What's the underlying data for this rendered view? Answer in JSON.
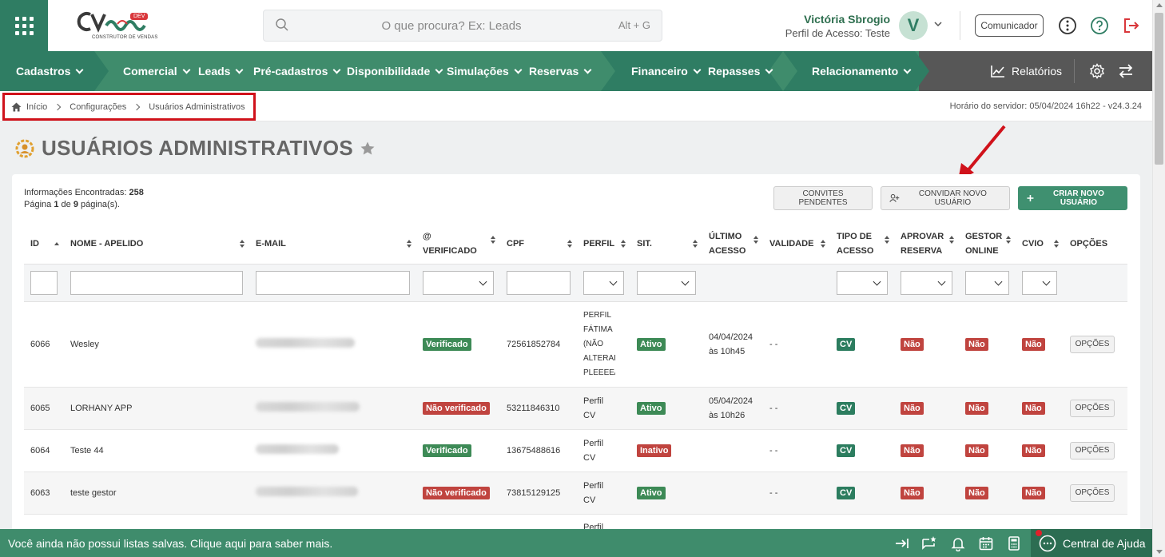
{
  "header": {
    "logo_tag": "DEV",
    "logo_sub": "CONSTRUTOR DE VENDAS",
    "search_placeholder": "O que procura? Ex: Leads",
    "search_shortcut": "Alt + G",
    "user_name": "Victória Sbrogio",
    "user_profile": "Perfil de Acesso: Teste",
    "avatar_letter": "V",
    "communicator_label": "Comunicador"
  },
  "nav": {
    "items": [
      "Cadastros",
      "Comercial",
      "Leads",
      "Pré-cadastros",
      "Disponibilidade",
      "Simulações",
      "Reservas",
      "Financeiro",
      "Repasses",
      "Relacionamento"
    ],
    "reports": "Relatórios",
    "colors": {
      "main": "#3f8c6c",
      "dark": "#2f7d63",
      "gray": "#575757"
    }
  },
  "breadcrumb": {
    "items": [
      "Início",
      "Configurações",
      "Usuários Administrativos"
    ],
    "server_time": "Horário do servidor: 05/04/2024 16h22 - v24.3.24"
  },
  "page": {
    "title": "USUÁRIOS ADMINISTRATIVOS"
  },
  "summary": {
    "found_label": "Informações Encontradas:",
    "found_count": "258",
    "page_label_1": "Página",
    "page_current": "1",
    "page_label_2": "de",
    "page_total": "9",
    "page_label_3": "página(s)."
  },
  "actions": {
    "pending_invites": "CONVITES PENDENTES",
    "invite_user": "CONVIDAR NOVO USUÁRIO",
    "create_user": "CRIAR NOVO USUÁRIO"
  },
  "table": {
    "headers": {
      "id": "ID",
      "name": "NOME - APELIDO",
      "email": "E-MAIL",
      "verified_1": "@",
      "verified_2": "VERIFICADO",
      "cpf": "CPF",
      "profile": "PERFIL",
      "status": "SIT.",
      "last_access_1": "ÚLTIMO",
      "last_access_2": "ACESSO",
      "validity": "VALIDADE",
      "access_type_1": "TIPO DE",
      "access_type_2": "ACESSO",
      "approve_1": "APROVAR",
      "approve_2": "RESERVA",
      "gestor_1": "GESTOR",
      "gestor_2": "ONLINE",
      "cvio": "CVIO",
      "options": "OPÇÕES"
    },
    "rows": [
      {
        "id": "6066",
        "name": "Wesley",
        "verified": "Verificado",
        "cpf": "72561852784",
        "profile": [
          "PERFIL",
          "FÁTIMA",
          "(NÃO",
          "ALTERAI",
          "PLEEEE/"
        ],
        "status": "Ativo",
        "last_access": [
          "04/04/2024",
          "às 10h45"
        ],
        "validity": "- -",
        "access_type": "CV",
        "approve": "Não",
        "gestor": "Não",
        "cvio": "Não",
        "options": "OPÇÕES"
      },
      {
        "id": "6065",
        "name": "LORHANY APP",
        "verified": "Não verificado",
        "cpf": "53211846310",
        "profile": [
          "Perfil",
          "CV"
        ],
        "status": "Ativo",
        "last_access": [
          "05/04/2024",
          "às 10h26"
        ],
        "validity": "- -",
        "access_type": "CV",
        "approve": "Não",
        "gestor": "Não",
        "cvio": "Não",
        "options": "OPÇÕES"
      },
      {
        "id": "6064",
        "name": "Teste 44",
        "verified": "Verificado",
        "cpf": "13675488616",
        "profile": [
          "Perfil",
          "CV"
        ],
        "status": "Inativo",
        "last_access": [
          "",
          ""
        ],
        "validity": "- -",
        "access_type": "CV",
        "approve": "Não",
        "gestor": "Não",
        "cvio": "Não",
        "options": "OPÇÕES"
      },
      {
        "id": "6063",
        "name": "teste gestor",
        "verified": "Não verificado",
        "cpf": "73815129125",
        "profile": [
          "Perfil",
          "CV"
        ],
        "status": "Ativo",
        "last_access": [
          "",
          ""
        ],
        "validity": "- -",
        "access_type": "CV",
        "approve": "Não",
        "gestor": "Não",
        "cvio": "Não",
        "options": "OPÇÕES"
      },
      {
        "id": "",
        "name": "",
        "verified": "",
        "cpf": "",
        "profile": [
          "Perfil",
          ""
        ],
        "status": "",
        "last_access": [
          "",
          ""
        ],
        "validity": "",
        "access_type": "",
        "approve": "",
        "gestor": "",
        "cvio": "",
        "options": ""
      }
    ]
  },
  "bottom": {
    "message": "Você ainda não possui listas salvas. Clique aqui para saber mais.",
    "help": "Central de Ajuda"
  },
  "colors": {
    "verified": "#3d8a56",
    "not_verified": "#c0443f",
    "highlight_box": "#d0121b"
  }
}
